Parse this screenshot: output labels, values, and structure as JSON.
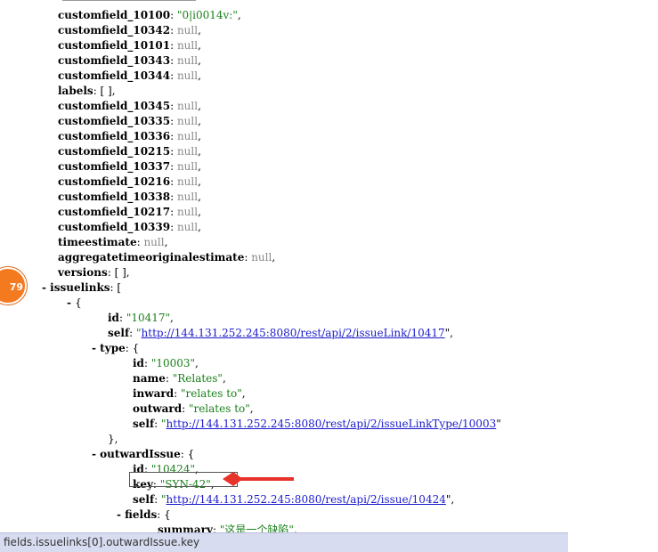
{
  "lines": [
    {
      "indent": 65,
      "key": "customfield_10100",
      "type": "str",
      "value": "\"0|i0014v:\"",
      "trail": ","
    },
    {
      "indent": 65,
      "key": "customfield_10342",
      "type": "null",
      "value": "null",
      "trail": ","
    },
    {
      "indent": 65,
      "key": "customfield_10101",
      "type": "null",
      "value": "null",
      "trail": ","
    },
    {
      "indent": 65,
      "key": "customfield_10343",
      "type": "null",
      "value": "null",
      "trail": ","
    },
    {
      "indent": 65,
      "key": "customfield_10344",
      "type": "null",
      "value": "null",
      "trail": ","
    },
    {
      "indent": 65,
      "key": "labels",
      "type": "plain",
      "value": "[ ]",
      "trail": ","
    },
    {
      "indent": 65,
      "key": "customfield_10345",
      "type": "null",
      "value": "null",
      "trail": ","
    },
    {
      "indent": 65,
      "key": "customfield_10335",
      "type": "null",
      "value": "null",
      "trail": ","
    },
    {
      "indent": 65,
      "key": "customfield_10336",
      "type": "null",
      "value": "null",
      "trail": ","
    },
    {
      "indent": 65,
      "key": "customfield_10215",
      "type": "null",
      "value": "null",
      "trail": ","
    },
    {
      "indent": 65,
      "key": "customfield_10337",
      "type": "null",
      "value": "null",
      "trail": ","
    },
    {
      "indent": 65,
      "key": "customfield_10216",
      "type": "null",
      "value": "null",
      "trail": ","
    },
    {
      "indent": 65,
      "key": "customfield_10338",
      "type": "null",
      "value": "null",
      "trail": ","
    },
    {
      "indent": 65,
      "key": "customfield_10217",
      "type": "null",
      "value": "null",
      "trail": ","
    },
    {
      "indent": 65,
      "key": "customfield_10339",
      "type": "null",
      "value": "null",
      "trail": ","
    },
    {
      "indent": 65,
      "key": "timeestimate",
      "type": "null",
      "value": "null",
      "trail": ","
    },
    {
      "indent": 65,
      "key": "aggregatetimeoriginalestimate",
      "type": "null",
      "value": "null",
      "trail": ","
    },
    {
      "indent": 65,
      "key": "versions",
      "type": "plain",
      "value": "[ ]",
      "trail": ","
    },
    {
      "indent": 65,
      "toggle": "- ",
      "key": "issuelinks",
      "type": "plain",
      "value": "[",
      "trail": ""
    },
    {
      "indent": 93,
      "toggle": "- ",
      "type": "plain",
      "value": "{",
      "trail": ""
    },
    {
      "indent": 121,
      "key": "id",
      "type": "str",
      "value": "\"10417\"",
      "trail": ","
    },
    {
      "indent": 121,
      "key": "self",
      "type": "link",
      "value": "http://144.131.252.245:8080/rest/api/2/issueLink/10417",
      "trail": "\","
    },
    {
      "indent": 121,
      "toggle": "- ",
      "key": "type",
      "type": "plain",
      "value": "{",
      "trail": ""
    },
    {
      "indent": 149,
      "key": "id",
      "type": "str",
      "value": "\"10003\"",
      "trail": ","
    },
    {
      "indent": 149,
      "key": "name",
      "type": "str",
      "value": "\"Relates\"",
      "trail": ","
    },
    {
      "indent": 149,
      "key": "inward",
      "type": "str",
      "value": "\"relates to\"",
      "trail": ","
    },
    {
      "indent": 149,
      "key": "outward",
      "type": "str",
      "value": "\"relates to\"",
      "trail": ","
    },
    {
      "indent": 149,
      "key": "self",
      "type": "link",
      "value": "http://144.131.252.245:8080/rest/api/2/issueLinkType/10003",
      "trail": "\""
    },
    {
      "indent": 121,
      "type": "plain",
      "value": "},",
      "trail": ""
    },
    {
      "indent": 121,
      "toggle": "- ",
      "key": "outwardIssue",
      "type": "plain",
      "value": "{",
      "trail": ""
    },
    {
      "indent": 149,
      "key": "id",
      "type": "str",
      "value": "\"10424\"",
      "trail": ","
    },
    {
      "indent": 149,
      "key": "key",
      "type": "str",
      "value": "\"SYN-42\"",
      "trail": ","
    },
    {
      "indent": 149,
      "key": "self",
      "type": "link",
      "value": "http://144.131.252.245:8080/rest/api/2/issue/10424",
      "trail": "\","
    },
    {
      "indent": 149,
      "toggle": "- ",
      "key": "fields",
      "type": "plain",
      "value": "{",
      "trail": ""
    },
    {
      "indent": 177,
      "key": "summary",
      "type": "str",
      "value": "\"这是一个缺陷\"",
      "trail": ","
    }
  ],
  "badge": {
    "text": "79"
  },
  "statusbar": {
    "path": "fields.issuelinks[0].outwardIssue.key"
  },
  "colors": {
    "arrow": "#e8332a",
    "badge": "#f47a20",
    "statusbar": "#d8dcf0"
  }
}
